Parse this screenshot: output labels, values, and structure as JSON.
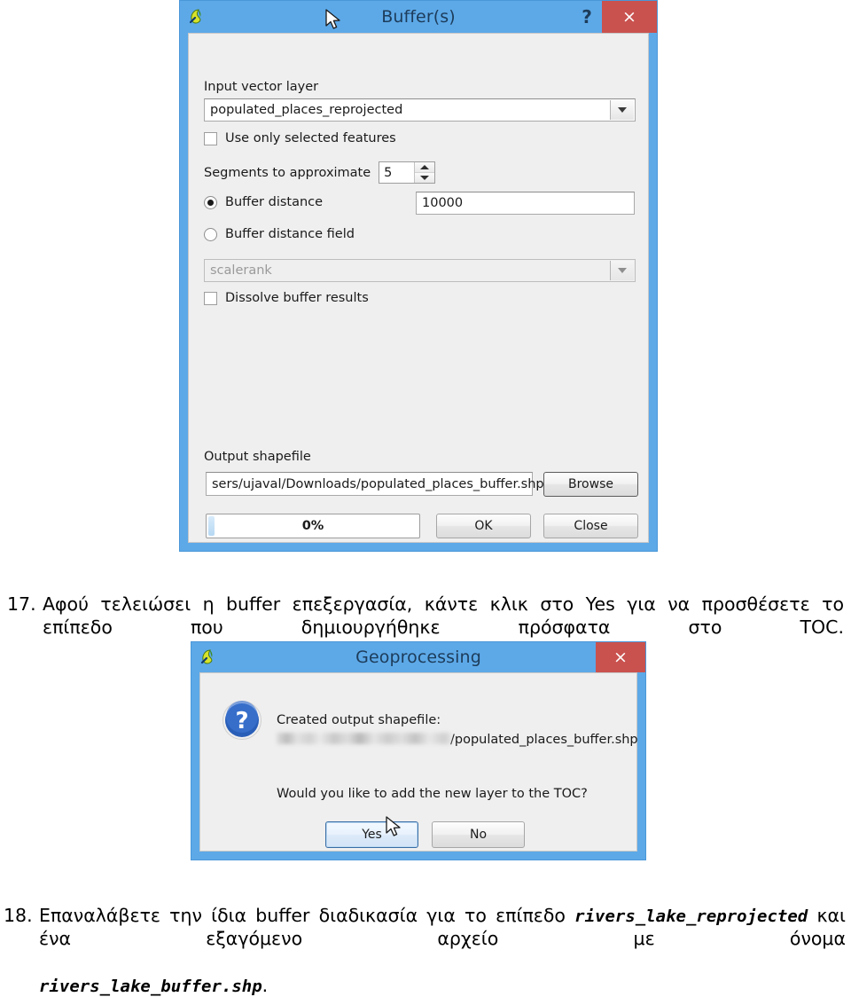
{
  "buffer_dialog": {
    "title": "Buffer(s)",
    "app_icon": "qgis-icon",
    "help_label": "?",
    "close_label": "×",
    "input_layer_label": "Input vector layer",
    "input_layer_value": "populated_places_reprojected",
    "use_selected_label": "Use only selected features",
    "use_selected_checked": false,
    "segments_label": "Segments to approximate",
    "segments_value": "5",
    "buffer_distance_label": "Buffer distance",
    "buffer_distance_selected": true,
    "buffer_distance_value": "10000",
    "buffer_field_label": "Buffer distance field",
    "buffer_field_selected": false,
    "buffer_field_value": "scalerank",
    "dissolve_label": "Dissolve buffer results",
    "dissolve_checked": false,
    "output_label": "Output shapefile",
    "output_value": "sers/ujaval/Downloads/populated_places_buffer.shp",
    "browse_label": "Browse",
    "progress_text": "0%",
    "progress_percent": 0,
    "ok_label": "OK",
    "close_button_label": "Close"
  },
  "step17": {
    "number": "17.",
    "text": "Αφού τελειώσει η buffer επεξεργασία, κάντε κλικ στο Yes για να προσθέσετε το επίπεδο που δημιουργήθηκε πρόσφατα στο TOC."
  },
  "geoprocessing_dialog": {
    "title": "Geoprocessing",
    "app_icon": "qgis-icon",
    "close_label": "×",
    "icon": "question-mark-icon",
    "message_line1": "Created output shapefile:",
    "message_path_suffix": "/populated_places_buffer.shp",
    "message_question": "Would you like to add the new layer to the TOC?",
    "yes_label": "Yes",
    "no_label": "No"
  },
  "step18": {
    "number": "18.",
    "text_part1": "Επαναλάβετε την ίδια buffer διαδικασία για το επίπεδο",
    "code1": "rivers_lake_reprojected",
    "text_part2": "και ένα εξαγόμενο αρχείο με όνομα",
    "code2": "rivers_lake_buffer.shp",
    "text_part3": "."
  },
  "colors": {
    "titlebar_blue": "#5da9e8",
    "close_red": "#c9524f",
    "dialog_bg": "#efefef",
    "icon_blue": "#2a5fb8"
  }
}
